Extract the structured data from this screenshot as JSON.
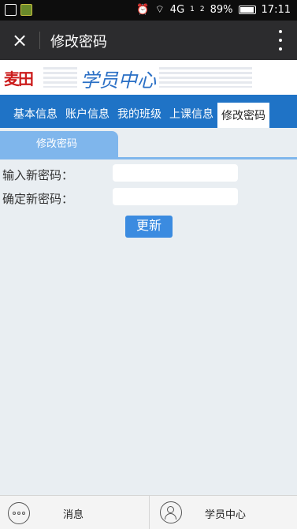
{
  "status_bar": {
    "signal": "4G",
    "sim1": "1",
    "sim2": "2",
    "battery": "89%",
    "time": "17:11"
  },
  "title_bar": {
    "title": "修改密码",
    "close_icon": "×"
  },
  "banner": {
    "logo_text": "麦田",
    "title": "学员中心"
  },
  "tabs": [
    {
      "label": "基本信息"
    },
    {
      "label": "账户信息"
    },
    {
      "label": "我的班级"
    },
    {
      "label": "上课信息"
    },
    {
      "label": "修改密码"
    }
  ],
  "active_tab": "修改密码",
  "sub_tab": {
    "label": "修改密码"
  },
  "form": {
    "new_password_label": "输入新密码：",
    "new_password_value": "",
    "confirm_password_label": "确定新密码：",
    "confirm_password_value": "",
    "update_button": "更新"
  },
  "bottom_nav": {
    "messages_label": "消息",
    "student_center_label": "学员中心"
  },
  "colors": {
    "tab_bar": "#1f73c6",
    "sub_tab": "#7fb6ec",
    "button": "#3b8be0",
    "title_bar": "#2c2c2e"
  }
}
